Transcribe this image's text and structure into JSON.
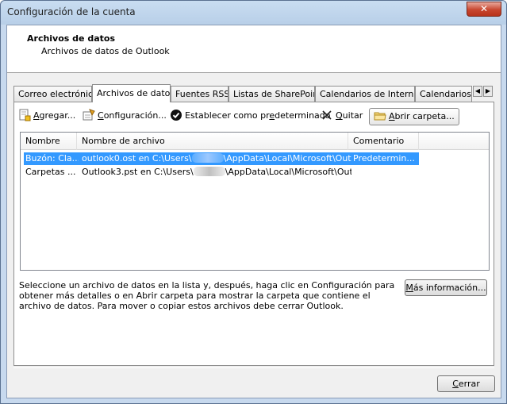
{
  "window": {
    "title": "Configuración de la cuenta",
    "close_glyph": "✕"
  },
  "header": {
    "title": "Archivos de datos",
    "subtitle": "Archivos de datos de Outlook"
  },
  "tabs": [
    {
      "label": "Correo electrónico",
      "active": false
    },
    {
      "label": "Archivos de datos",
      "active": true
    },
    {
      "label": "Fuentes RSS",
      "active": false
    },
    {
      "label": "Listas de SharePoint",
      "active": false
    },
    {
      "label": "Calendarios de Internet",
      "active": false
    },
    {
      "label": "Calendarios p",
      "active": false
    }
  ],
  "toolbar": {
    "add": {
      "pre": "",
      "u": "A",
      "post": "gregar..."
    },
    "settings": {
      "pre": "",
      "u": "C",
      "post": "onfiguración..."
    },
    "default": {
      "pre": "Establecer como pr",
      "u": "e",
      "post": "determinado"
    },
    "remove": {
      "pre": "",
      "u": "Q",
      "post": "uitar"
    },
    "open": {
      "pre": "",
      "u": "A",
      "post": "brir carpeta..."
    }
  },
  "list": {
    "columns": [
      "Nombre",
      "Nombre de archivo",
      "Comentario"
    ],
    "rows": [
      {
        "name": "Buzón: Cla...",
        "file_pre": "outlook0.ost en C:\\Users\\",
        "file_post": "\\AppData\\Local\\Microsoft\\Outlook",
        "comment": "Predetermin..."
      },
      {
        "name": "Carpetas ...",
        "file_pre": "Outlook3.pst en C:\\Users\\",
        "file_post": "\\AppData\\Local\\Microsoft\\Outlook",
        "comment": ""
      }
    ]
  },
  "info_text": "Seleccione un archivo de datos en la lista y, después, haga clic en Configuración para obtener más detalles o en Abrir carpeta para mostrar la carpeta que contiene el archivo de datos. Para mover o copiar estos archivos debe cerrar Outlook.",
  "buttons": {
    "more_info": {
      "pre": "",
      "u": "M",
      "post": "ás información..."
    },
    "close": {
      "pre": "",
      "u": "C",
      "post": "errar"
    }
  },
  "colors": {
    "selection": "#3399ff",
    "close_button": "#c7462f"
  }
}
